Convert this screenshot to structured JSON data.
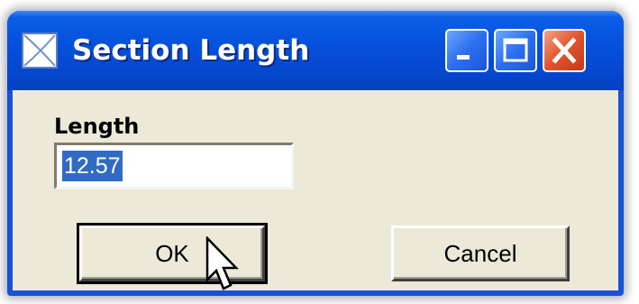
{
  "window": {
    "title": "Section Length",
    "icon": "app-icon",
    "controls": [
      "minimize-icon",
      "maximize-icon",
      "close-icon"
    ]
  },
  "form": {
    "length_label": "Length",
    "length_value": "12.57"
  },
  "buttons": {
    "ok_label": "OK",
    "cancel_label": "Cancel"
  },
  "colors": {
    "titlebar": "#0652dc",
    "client": "#ece9d8",
    "selection": "#316ac5",
    "close_button": "#e0532c"
  }
}
